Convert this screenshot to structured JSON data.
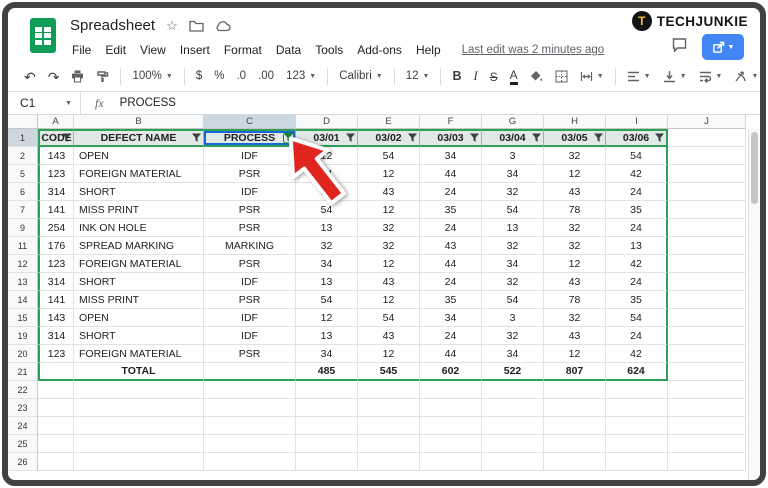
{
  "titlebar": {
    "title": "Spreadsheet"
  },
  "menubar": {
    "items": [
      "File",
      "Edit",
      "View",
      "Insert",
      "Format",
      "Data",
      "Tools",
      "Add-ons",
      "Help"
    ],
    "last_edit": "Last edit was 2 minutes ago"
  },
  "toolbar": {
    "zoom_value": "100%",
    "currency": "$",
    "percent": "%",
    "decimal_decrease": ".0",
    "decimal_increase": ".00",
    "number_format": "123",
    "font_name": "Calibri",
    "font_size": "12",
    "bold": "B",
    "italic": "I",
    "strikethrough": "S",
    "text_color": "A"
  },
  "formula_bar": {
    "cell_ref": "C1",
    "fx_label": "fx",
    "value": "PROCESS"
  },
  "logo": {
    "gear_letter": "T",
    "text": "TECHJUNKIE"
  },
  "selection": {
    "cell_ref": "C1",
    "column_letter": "C",
    "row_number": 1
  },
  "sheet": {
    "column_letters": [
      "A",
      "B",
      "C",
      "D",
      "E",
      "F",
      "G",
      "H",
      "I",
      "J"
    ],
    "active_filter_column_index": 2,
    "rows": [
      {
        "n": 1,
        "type": "header",
        "cells": [
          "CODE",
          "DEFECT NAME",
          "PROCESS",
          "03/01",
          "03/02",
          "03/03",
          "03/04",
          "03/05",
          "03/06"
        ]
      },
      {
        "n": 2,
        "cells": [
          "143",
          "OPEN",
          "IDF",
          "12",
          "54",
          "34",
          "3",
          "32",
          "54"
        ]
      },
      {
        "n": 5,
        "cells": [
          "123",
          "FOREIGN MATERIAL",
          "PSR",
          "34",
          "12",
          "44",
          "34",
          "12",
          "42"
        ]
      },
      {
        "n": 6,
        "cells": [
          "314",
          "SHORT",
          "IDF",
          "13",
          "43",
          "24",
          "32",
          "43",
          "24"
        ]
      },
      {
        "n": 7,
        "cells": [
          "141",
          "MISS PRINT",
          "PSR",
          "54",
          "12",
          "35",
          "54",
          "78",
          "35"
        ]
      },
      {
        "n": 9,
        "cells": [
          "254",
          "INK ON HOLE",
          "PSR",
          "13",
          "32",
          "24",
          "13",
          "32",
          "24"
        ]
      },
      {
        "n": 11,
        "cells": [
          "176",
          "SPREAD MARKING",
          "MARKING",
          "32",
          "32",
          "43",
          "32",
          "32",
          "13"
        ]
      },
      {
        "n": 12,
        "cells": [
          "123",
          "FOREIGN MATERIAL",
          "PSR",
          "34",
          "12",
          "44",
          "34",
          "12",
          "42"
        ]
      },
      {
        "n": 13,
        "cells": [
          "314",
          "SHORT",
          "IDF",
          "13",
          "43",
          "24",
          "32",
          "43",
          "24"
        ]
      },
      {
        "n": 14,
        "cells": [
          "141",
          "MISS PRINT",
          "PSR",
          "54",
          "12",
          "35",
          "54",
          "78",
          "35"
        ]
      },
      {
        "n": 15,
        "cells": [
          "143",
          "OPEN",
          "IDF",
          "12",
          "54",
          "34",
          "3",
          "32",
          "54"
        ]
      },
      {
        "n": 19,
        "cells": [
          "314",
          "SHORT",
          "IDF",
          "13",
          "43",
          "24",
          "32",
          "43",
          "24"
        ]
      },
      {
        "n": 20,
        "cells": [
          "123",
          "FOREIGN MATERIAL",
          "PSR",
          "34",
          "12",
          "44",
          "34",
          "12",
          "42"
        ]
      },
      {
        "n": 21,
        "type": "total",
        "cells": [
          "",
          "TOTAL",
          "",
          "485",
          "545",
          "602",
          "522",
          "807",
          "624"
        ]
      },
      {
        "n": 22,
        "cells": []
      },
      {
        "n": 23,
        "cells": []
      },
      {
        "n": 24,
        "cells": []
      },
      {
        "n": 25,
        "cells": []
      },
      {
        "n": 26,
        "cells": []
      }
    ]
  },
  "colors": {
    "sheets_green": "#0f9d58",
    "filter_active_green": "#188038",
    "range_border_green": "#2f9e58",
    "selection_blue": "#1967d2",
    "share_button_blue": "#4285f4",
    "arrow_red": "#e0251f",
    "logo_yellow": "#f6b93b"
  }
}
